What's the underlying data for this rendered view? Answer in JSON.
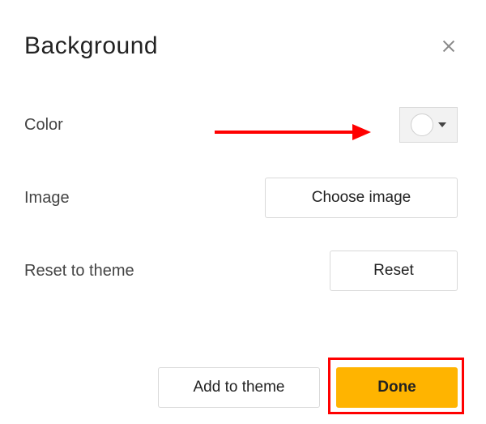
{
  "dialog": {
    "title": "Background",
    "rows": {
      "color": {
        "label": "Color",
        "swatch_color": "#ffffff"
      },
      "image": {
        "label": "Image",
        "button_label": "Choose image"
      },
      "reset": {
        "label": "Reset to theme",
        "button_label": "Reset"
      }
    },
    "footer": {
      "add_to_theme_label": "Add to theme",
      "done_label": "Done"
    }
  },
  "annotations": {
    "arrow_target": "color-picker",
    "highlight_target": "done-button"
  }
}
